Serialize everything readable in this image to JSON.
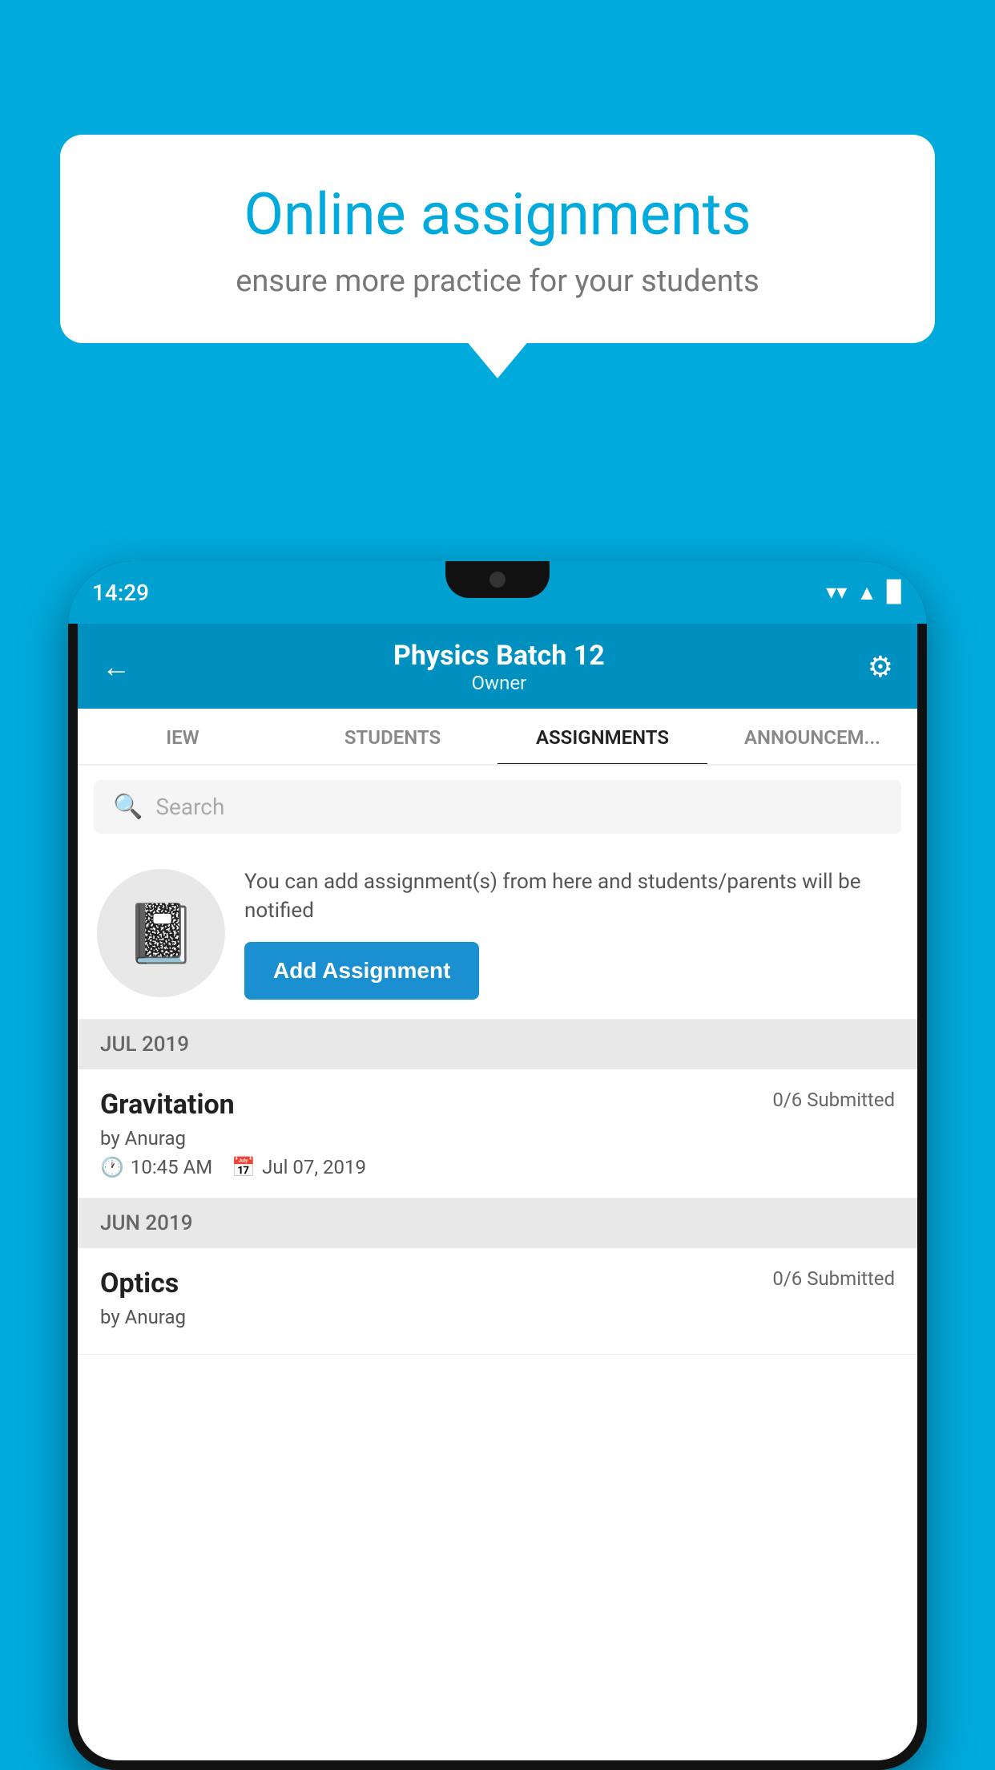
{
  "background_color": "#00AADD",
  "bubble": {
    "title": "Online assignments",
    "subtitle": "ensure more practice for your students"
  },
  "phone": {
    "status_bar": {
      "time": "14:29",
      "wifi": "▲",
      "signal": "▲",
      "battery": "▉"
    },
    "header": {
      "title": "Physics Batch 12",
      "subtitle": "Owner",
      "back_label": "←",
      "gear_label": "⚙"
    },
    "tabs": [
      {
        "label": "IEW",
        "active": false
      },
      {
        "label": "STUDENTS",
        "active": false
      },
      {
        "label": "ASSIGNMENTS",
        "active": true
      },
      {
        "label": "ANNOUNCEM...",
        "active": false
      }
    ],
    "search": {
      "placeholder": "Search"
    },
    "info": {
      "description": "You can add assignment(s) from here and students/parents will be notified",
      "add_button_label": "Add Assignment"
    },
    "sections": [
      {
        "month_label": "JUL 2019",
        "assignments": [
          {
            "name": "Gravitation",
            "submitted": "0/6 Submitted",
            "by": "by Anurag",
            "time": "10:45 AM",
            "date": "Jul 07, 2019"
          }
        ]
      },
      {
        "month_label": "JUN 2019",
        "assignments": [
          {
            "name": "Optics",
            "submitted": "0/6 Submitted",
            "by": "by Anurag",
            "time": "",
            "date": ""
          }
        ]
      }
    ]
  }
}
